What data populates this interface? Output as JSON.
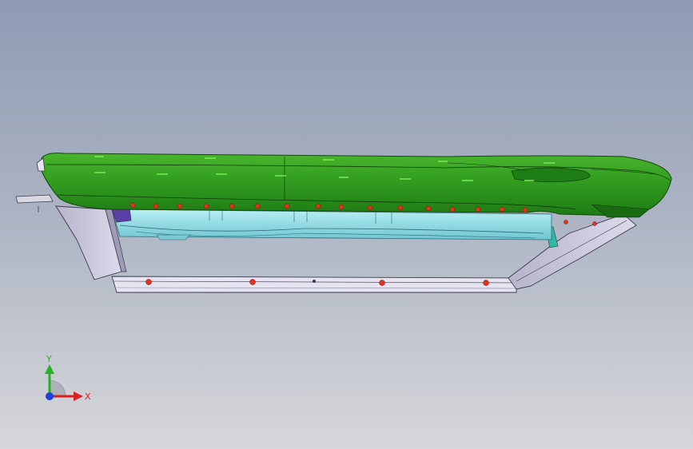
{
  "viewport": {
    "background_top": "#8e9bb3",
    "background_bottom": "#d6d7da"
  },
  "model": {
    "main_color": "#2f9a1f",
    "main_highlight": "#5cd23a",
    "frame_color": "#c9c6dc",
    "frame_edge": "#3a3a4a",
    "inner_color": "#8fd8e0",
    "teal_color": "#34b7a7",
    "marker_color": "#e0321e"
  },
  "triad": {
    "x_label": "X",
    "y_label": "Y",
    "x_color": "#d92020",
    "y_color": "#28b028",
    "z_color": "#1c3fd8"
  }
}
